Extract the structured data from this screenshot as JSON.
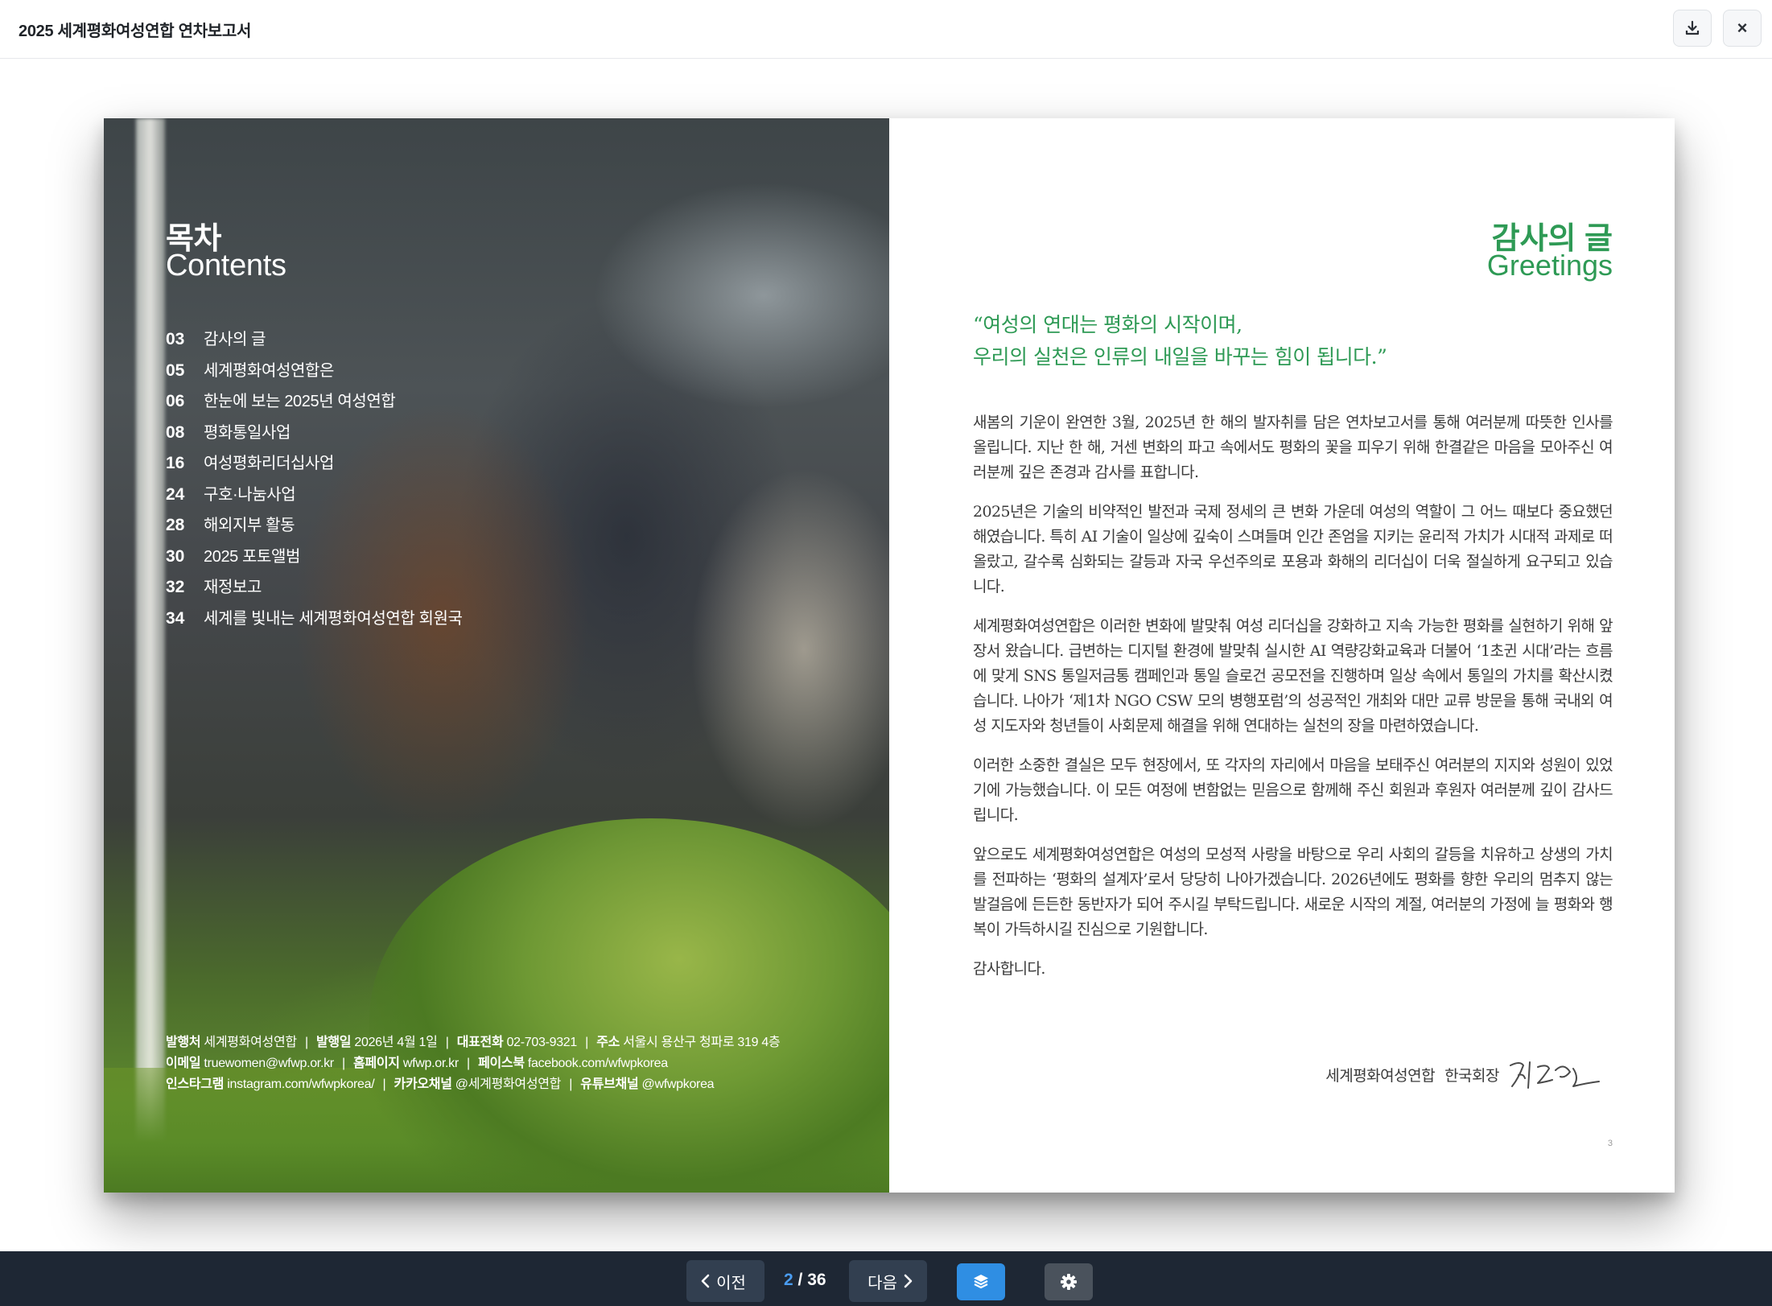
{
  "header": {
    "title": "2025 세계평화여성연합 연차보고서",
    "download_icon": "download-icon",
    "close_icon": "close-icon",
    "close_glyph": "×"
  },
  "left_page": {
    "heading_ko": "목차",
    "heading_en": "Contents",
    "toc": [
      {
        "num": "03",
        "label": "감사의 글"
      },
      {
        "num": "05",
        "label": "세계평화여성연합은"
      },
      {
        "num": "06",
        "label": "한눈에 보는 2025년 여성연합"
      },
      {
        "num": "08",
        "label": "평화통일사업"
      },
      {
        "num": "16",
        "label": "여성평화리더십사업"
      },
      {
        "num": "24",
        "label": "구호·나눔사업"
      },
      {
        "num": "28",
        "label": "해외지부 활동"
      },
      {
        "num": "30",
        "label": "2025 포토앨범"
      },
      {
        "num": "32",
        "label": "재정보고"
      },
      {
        "num": "34",
        "label": "세계를 빛내는 세계평화여성연합 회원국"
      }
    ],
    "imprint": {
      "publisher_label": "발행처",
      "publisher": "세계평화여성연합",
      "date_label": "발행일",
      "date": "2026년 4월 1일",
      "phone_label": "대표전화",
      "phone": "02-703-9321",
      "address_label": "주소",
      "address": "서울시 용산구 청파로 319 4층",
      "email_label": "이메일",
      "email": "truewomen@wfwp.or.kr",
      "homepage_label": "홈페이지",
      "homepage": "wfwp.or.kr",
      "facebook_label": "페이스북",
      "facebook": "facebook.com/wfwpkorea",
      "instagram_label": "인스타그램",
      "instagram": "instagram.com/wfwpkorea/",
      "kakao_label": "카카오채널",
      "kakao": "@세계평화여성연합",
      "youtube_label": "유튜브채널",
      "youtube": "@wfwpkorea",
      "separator": "|"
    }
  },
  "right_page": {
    "heading_ko": "감사의 글",
    "heading_en": "Greetings",
    "quote_line1": "“여성의 연대는 평화의 시작이며,",
    "quote_line2": "우리의 실천은 인류의 내일을 바꾸는 힘이 됩니다.”",
    "paragraphs": [
      "새봄의 기운이 완연한 3월, 2025년 한 해의 발자취를 담은 연차보고서를 통해 여러분께 따뜻한 인사를 올립니다. 지난 한 해, 거센 변화의 파고 속에서도 평화의 꽃을 피우기 위해 한결같은 마음을 모아주신 여러분께 깊은 존경과 감사를 표합니다.",
      "2025년은 기술의 비약적인 발전과 국제 정세의 큰 변화 가운데 여성의 역할이 그 어느 때보다 중요했던 해였습니다. 특히 AI 기술이 일상에 깊숙이 스며들며 인간 존엄을 지키는 윤리적 가치가 시대적 과제로 떠올랐고, 갈수록 심화되는 갈등과 자국 우선주의로 포용과 화해의 리더십이 더욱 절실하게 요구되고 있습니다.",
      "세계평화여성연합은 이러한 변화에 발맞춰 여성 리더십을 강화하고 지속 가능한 평화를 실현하기 위해 앞장서 왔습니다. 급변하는 디지털 환경에 발맞춰 실시한 AI 역량강화교육과 더불어 ‘1초귄 시대’라는 흐름에 맞게 SNS 통일저금통 캠페인과 통일 슬로건 공모전을 진행하며 일상 속에서 통일의 가치를 확산시켰습니다. 나아가 ‘제1차 NGO CSW 모의 병행포럼’의 성공적인 개최와 대만 교류 방문을 통해 국내외 여성 지도자와 청년들이 사회문제 해결을 위해 연대하는 실천의 장을 마련하였습니다.",
      "이러한 소중한 결실은 모두 현장에서, 또 각자의 자리에서 마음을 보태주신 여러분의 지지와 성원이 있었기에 가능했습니다. 이 모든 여정에 변함없는 믿음으로 함께해 주신 회원과 후원자 여러분께 깊이 감사드립니다.",
      "앞으로도 세계평화여성연합은 여성의 모성적 사랑을 바탕으로 우리 사회의 갈등을 치유하고 상생의 가치를 전파하는 ‘평화의 설계자’로서 당당히 나아가겠습니다. 2026년에도 평화를 향한 우리의 멈추지 않는 발걸음에 든든한 동반자가 되어 주시길 부탁드립니다. 새로운 시작의 계절, 여러분의 가정에 늘 평화와 행복이 가득하시길 진심으로 기원합니다.",
      "감사합니다."
    ],
    "sign_org": "세계평화여성연합",
    "sign_role": "한국회장",
    "page_number": "3"
  },
  "toolbar": {
    "prev_label": "이전",
    "next_label": "다음",
    "current_page": "2",
    "page_sep": " / ",
    "total_pages": "36",
    "layers_icon": "layers-icon",
    "settings_icon": "gear-icon"
  },
  "colors": {
    "accent_green": "#2e9a55",
    "toolbar_bg": "#1e2734",
    "nav_btn_bg": "#323f50",
    "layers_btn": "#2f8ee3",
    "settings_btn": "#4a525c",
    "current_page": "#4a9cf0"
  }
}
